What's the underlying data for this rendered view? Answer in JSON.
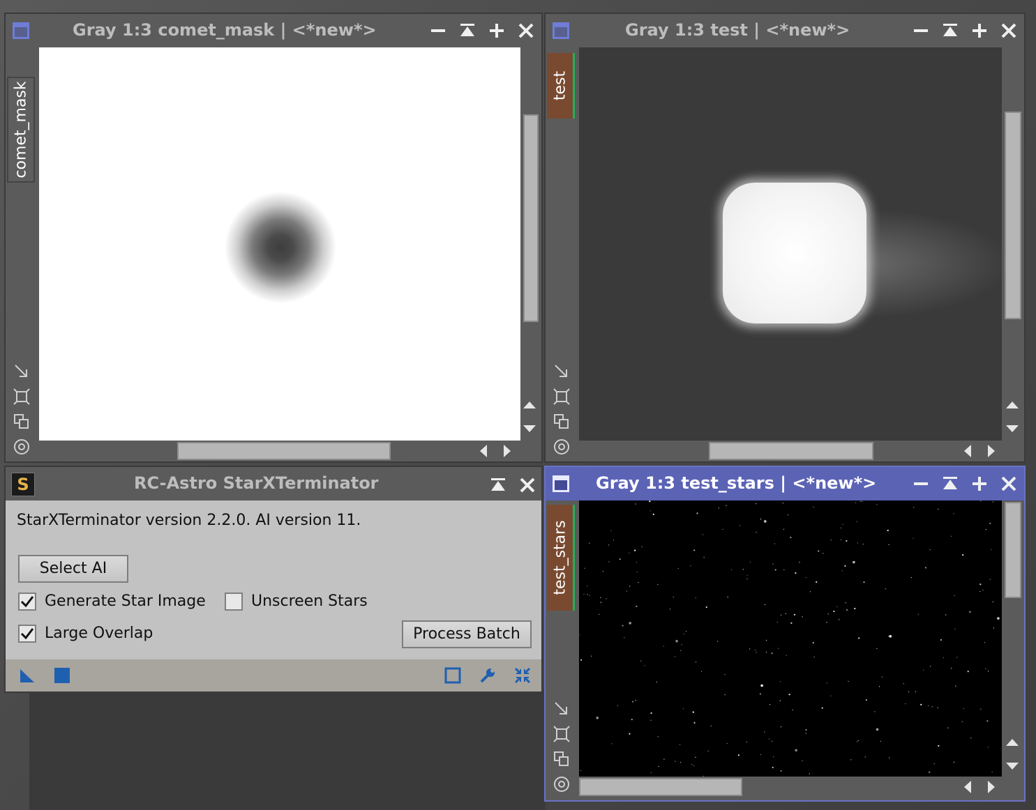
{
  "windows": {
    "comet_mask": {
      "title": "Gray 1:3 comet_mask | <*new*>",
      "tab": "comet_mask"
    },
    "test": {
      "title": "Gray 1:3 test | <*new*>",
      "tab": "test"
    },
    "test_stars": {
      "title": "Gray 1:3 test_stars | <*new*>",
      "tab": "test_stars"
    }
  },
  "tool": {
    "logo": "S",
    "title": "RC-Astro StarXTerminator",
    "version_text": "StarXTerminator version 2.2.0. AI version 11.",
    "select_ai": "Select AI",
    "generate_star_image": {
      "label": "Generate Star Image",
      "checked": true
    },
    "unscreen_stars": {
      "label": "Unscreen Stars",
      "checked": false
    },
    "large_overlap": {
      "label": "Large Overlap",
      "checked": true
    },
    "process_batch": "Process Batch"
  },
  "colors": {
    "active_title": "#5b63b5",
    "tab_bg": "#7a4a30",
    "tab_marker": "#1fb15a",
    "tool_icons": "#1f5fb0"
  }
}
